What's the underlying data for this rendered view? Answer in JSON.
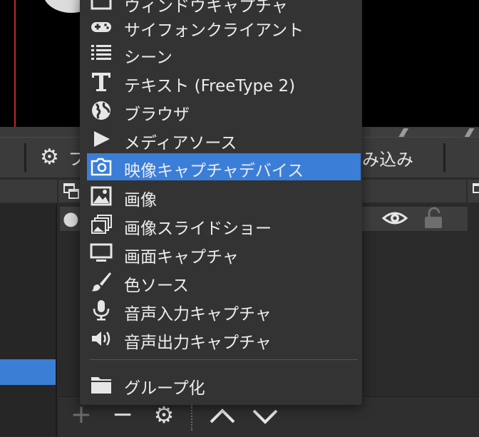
{
  "controls": {
    "settings_fragment": "プ",
    "import_fragment": "み込み"
  },
  "menu": {
    "items": [
      {
        "label": "ウィンドウキャプチャ",
        "icon": "window-capture-icon"
      },
      {
        "label": "サイフォンクライアント",
        "icon": "gamepad-icon"
      },
      {
        "label": "シーン",
        "icon": "list-icon"
      },
      {
        "label": "テキスト (FreeType 2)",
        "icon": "text-icon"
      },
      {
        "label": "ブラウザ",
        "icon": "globe-icon"
      },
      {
        "label": "メディアソース",
        "icon": "play-icon"
      },
      {
        "label": "映像キャプチャデバイス",
        "icon": "camera-icon",
        "selected": true
      },
      {
        "label": "画像",
        "icon": "image-icon"
      },
      {
        "label": "画像スライドショー",
        "icon": "slideshow-icon"
      },
      {
        "label": "画面キャプチャ",
        "icon": "monitor-icon"
      },
      {
        "label": "色ソース",
        "icon": "brush-icon"
      },
      {
        "label": "音声入力キャプチャ",
        "icon": "microphone-icon"
      },
      {
        "label": "音声出力キャプチャ",
        "icon": "speaker-icon"
      }
    ],
    "group": {
      "label": "グループ化",
      "icon": "folder-icon"
    }
  },
  "toolbar": {
    "add": "+",
    "remove": "−"
  },
  "colors": {
    "accent": "#3a7ed8",
    "menu_bg": "#333333",
    "panel_bg": "#2b2b2b"
  }
}
